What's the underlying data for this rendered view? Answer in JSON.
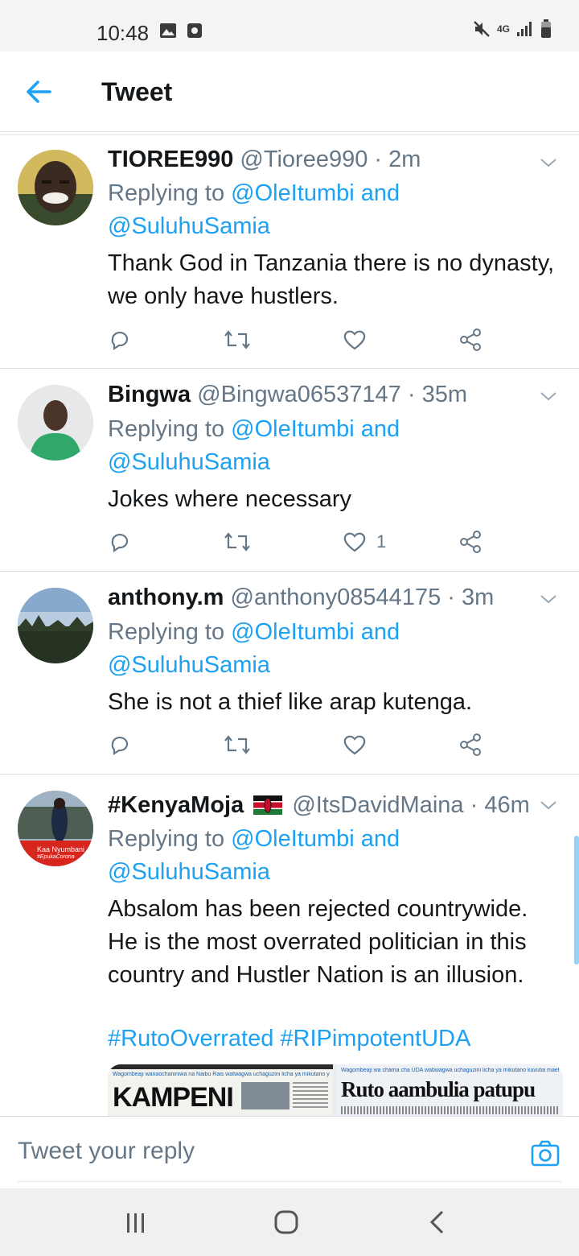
{
  "status_bar": {
    "time": "10:48",
    "network": "4G",
    "icons": [
      "image-icon",
      "media-icon",
      "mute-icon",
      "network-4g-icon",
      "signal-icon",
      "battery-icon"
    ]
  },
  "app_bar": {
    "title": "Tweet",
    "back_icon": "back-arrow-icon"
  },
  "colors": {
    "accent": "#1da1f2",
    "text": "#14171a",
    "secondary": "#657786"
  },
  "tweets": [
    {
      "name": "TIOREE990",
      "handle": "@Tioree990",
      "time": "2m",
      "replying_prefix": "Replying to ",
      "mention1": "@OleItumbi",
      "joiner": " and",
      "mention2": "@SuluhuSamia",
      "text": "Thank God in Tanzania there is no dynasty,\nwe only have hustlers.",
      "likes": ""
    },
    {
      "name": "Bingwa",
      "handle": "@Bingwa06537147",
      "time": "35m",
      "replying_prefix": "Replying to ",
      "mention1": "@OleItumbi",
      "joiner": " and",
      "mention2": "@SuluhuSamia",
      "text": "Jokes where necessary",
      "likes": "1"
    },
    {
      "name": "anthony.m",
      "handle": "@anthony08544175",
      "time": "3m",
      "replying_prefix": "Replying to ",
      "mention1": "@OleItumbi",
      "joiner": " and",
      "mention2": "@SuluhuSamia",
      "text": "She is not a thief like arap kutenga.",
      "likes": ""
    },
    {
      "name": "#KenyaMoja",
      "handle": "@ItsDavidMaina",
      "time": "46m",
      "replying_prefix": "Replying to ",
      "mention1": "@OleItumbi",
      "joiner": " and",
      "mention2": "@SuluhuSamia",
      "text": "Absalom has been rejected countrywide.\nHe is the most overrated politician in this\ncountry and Hustler Nation is an illusion.",
      "hashtags": "#RutoOverrated #RIPimpotentUDA",
      "avatar_caption": "Kaa Nyumbani",
      "avatar_caption2": "#EpukaCorona",
      "media": {
        "left_headline": "KAMPENI",
        "left_strap": "Wagombeaji wanaochaniniwa na Naibu Rais watwagwa uchaguzini licha ya mikutano yake kuvutia watu wengi",
        "right_headline": "Ruto aambulia patupu",
        "right_strap": "Wagombeaji wa chama cha UDA wabwagwa uchaguzini licha ya mikutano kuvutia maelfu"
      }
    }
  ],
  "time_separator": " · ",
  "reply_bar": {
    "placeholder": "Tweet your reply"
  },
  "nav_bar": {
    "buttons": [
      "recent-apps-icon",
      "home-icon",
      "back-icon"
    ]
  }
}
